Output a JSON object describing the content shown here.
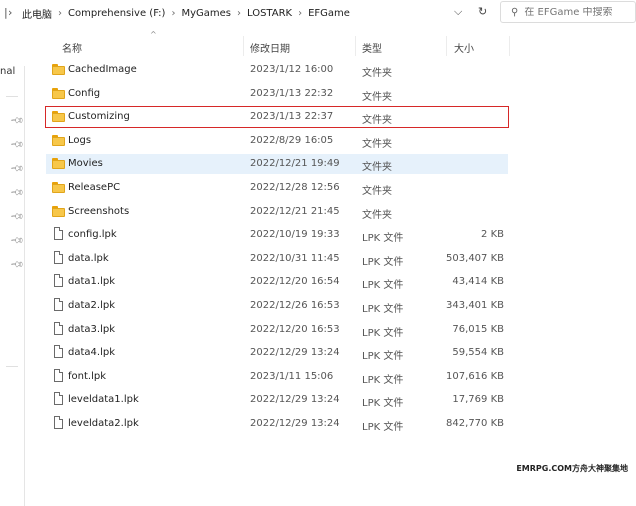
{
  "address": {
    "crumbs": [
      "此电脑",
      "Comprehensive (F:)",
      "MyGames",
      "LOSTARK",
      "EFGame"
    ],
    "separator": "›",
    "dropdown_icon": "chevron-down-icon",
    "refresh_icon": "refresh-icon"
  },
  "search": {
    "placeholder": "在 EFGame 中搜索"
  },
  "nav": {
    "label": "nal",
    "pins": 7
  },
  "columns": {
    "name": "名称",
    "date": "修改日期",
    "type": "类型",
    "size": "大小"
  },
  "files": [
    {
      "name": "CachedImage",
      "date": "2023/1/12 16:00",
      "type": "文件夹",
      "size": "",
      "kind": "folder"
    },
    {
      "name": "Config",
      "date": "2023/1/13 22:32",
      "type": "文件夹",
      "size": "",
      "kind": "folder"
    },
    {
      "name": "Customizing",
      "date": "2023/1/13 22:37",
      "type": "文件夹",
      "size": "",
      "kind": "folder",
      "highlighted": true
    },
    {
      "name": "Logs",
      "date": "2022/8/29 16:05",
      "type": "文件夹",
      "size": "",
      "kind": "folder"
    },
    {
      "name": "Movies",
      "date": "2022/12/21 19:49",
      "type": "文件夹",
      "size": "",
      "kind": "folder",
      "hover": true
    },
    {
      "name": "ReleasePC",
      "date": "2022/12/28 12:56",
      "type": "文件夹",
      "size": "",
      "kind": "folder"
    },
    {
      "name": "Screenshots",
      "date": "2022/12/21 21:45",
      "type": "文件夹",
      "size": "",
      "kind": "folder"
    },
    {
      "name": "config.lpk",
      "date": "2022/10/19 19:33",
      "type": "LPK 文件",
      "size": "2 KB",
      "kind": "file"
    },
    {
      "name": "data.lpk",
      "date": "2022/10/31 11:45",
      "type": "LPK 文件",
      "size": "503,407 KB",
      "kind": "file"
    },
    {
      "name": "data1.lpk",
      "date": "2022/12/20 16:54",
      "type": "LPK 文件",
      "size": "43,414 KB",
      "kind": "file"
    },
    {
      "name": "data2.lpk",
      "date": "2022/12/26 16:53",
      "type": "LPK 文件",
      "size": "343,401 KB",
      "kind": "file"
    },
    {
      "name": "data3.lpk",
      "date": "2022/12/20 16:53",
      "type": "LPK 文件",
      "size": "76,015 KB",
      "kind": "file"
    },
    {
      "name": "data4.lpk",
      "date": "2022/12/29 13:24",
      "type": "LPK 文件",
      "size": "59,554 KB",
      "kind": "file"
    },
    {
      "name": "font.lpk",
      "date": "2023/1/11 15:06",
      "type": "LPK 文件",
      "size": "107,616 KB",
      "kind": "file"
    },
    {
      "name": "leveldata1.lpk",
      "date": "2022/12/29 13:24",
      "type": "LPK 文件",
      "size": "17,769 KB",
      "kind": "file"
    },
    {
      "name": "leveldata2.lpk",
      "date": "2022/12/29 13:24",
      "type": "LPK 文件",
      "size": "842,770 KB",
      "kind": "file"
    }
  ],
  "watermark": "EMRPG.COM方舟大神聚集地",
  "colors": {
    "highlight_box": "#d62828",
    "hover_row": "#e6f1fb",
    "folder": "#f7c74a"
  }
}
